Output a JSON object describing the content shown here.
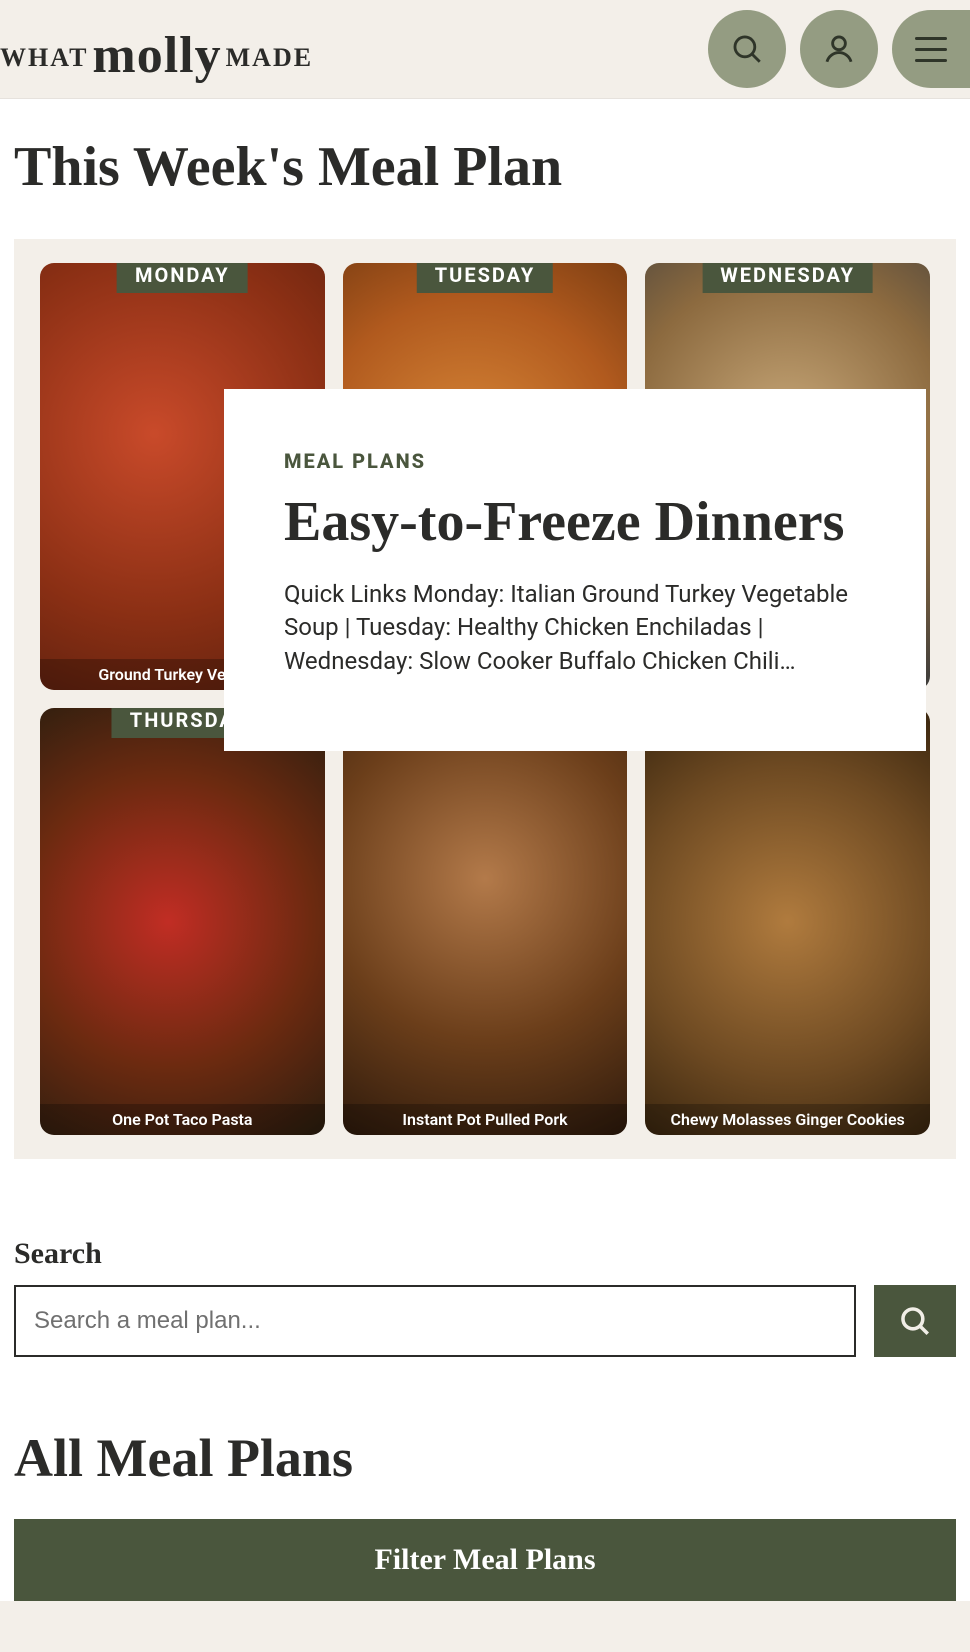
{
  "header": {
    "logo": {
      "prefix": "WHAT",
      "brand": "molly",
      "suffix": "MADE"
    }
  },
  "page": {
    "title": "This Week's Meal Plan",
    "all_title": "All Meal Plans",
    "filter_label": "Filter Meal Plans"
  },
  "hero": {
    "meals": [
      {
        "day": "MONDAY",
        "caption": "Ground Turkey Vegetab"
      },
      {
        "day": "TUESDAY",
        "caption": ""
      },
      {
        "day": "WEDNESDAY",
        "caption": ""
      },
      {
        "day": "THURSDA",
        "caption": "One Pot Taco Pasta"
      },
      {
        "day": "",
        "caption": "Instant Pot Pulled Pork"
      },
      {
        "day": "",
        "caption": "Chewy Molasses Ginger Cookies"
      }
    ],
    "overlay": {
      "category": "MEAL PLANS",
      "title": "Easy-to-Freeze Dinners",
      "desc": "Quick Links Monday: Italian Ground Turkey Vegetable Soup | Tuesday: Healthy Chicken Enchiladas | Wednesday: Slow Cooker Buffalo Chicken Chili…"
    }
  },
  "search": {
    "label": "Search",
    "placeholder": "Search a meal plan..."
  }
}
